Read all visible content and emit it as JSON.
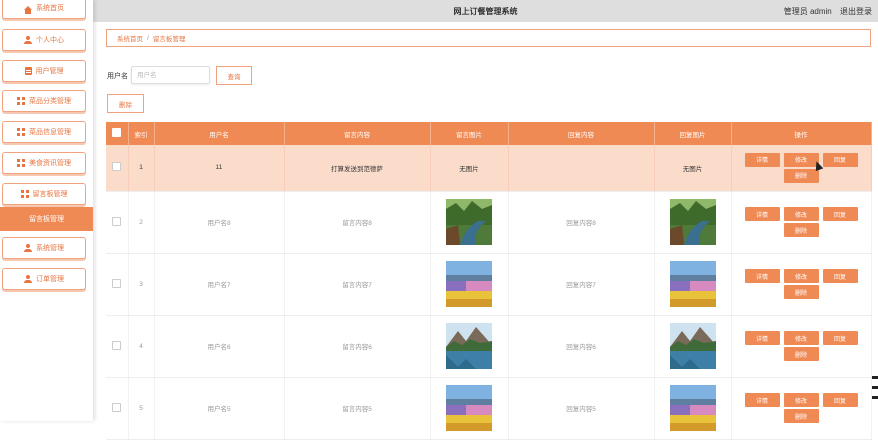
{
  "header": {
    "title": "网上订餐管理系统",
    "admin_label": "管理员 admin",
    "logout_label": "退出登录"
  },
  "sidebar": {
    "items": [
      {
        "label": "系统首页",
        "icon": "home-icon"
      },
      {
        "label": "个人中心",
        "icon": "user-icon"
      },
      {
        "label": "用户管理",
        "icon": "document-icon"
      },
      {
        "label": "菜品分类管理",
        "icon": "grid-icon"
      },
      {
        "label": "菜品信息管理",
        "icon": "grid-icon"
      },
      {
        "label": "美食资讯管理",
        "icon": "grid-icon"
      },
      {
        "label": "留言板管理",
        "icon": "grid-icon"
      },
      {
        "label": "留言板管理",
        "icon": "",
        "active": true
      },
      {
        "label": "系统管理",
        "icon": "user-icon"
      },
      {
        "label": "订单管理",
        "icon": "user-icon"
      }
    ]
  },
  "breadcrumb": {
    "home": "系统首页",
    "separator": "/",
    "current": "留言板管理"
  },
  "search": {
    "label": "用户名",
    "placeholder": "用户名",
    "button_label": "查询"
  },
  "toolbar": {
    "delete_label": "删除"
  },
  "table": {
    "columns": [
      "索引",
      "用户名",
      "留言内容",
      "留言图片",
      "回复内容",
      "回复图片",
      "操作"
    ],
    "actions": [
      "详情",
      "修改",
      "回复",
      "删除"
    ],
    "rows": [
      {
        "index": "1",
        "username": "11",
        "message": "打算发送到范德萨",
        "msg_image_text": "无图片",
        "reply": "",
        "reply_image_text": "无图片",
        "msg_image": "",
        "reply_image": ""
      },
      {
        "index": "2",
        "username": "用户名8",
        "message": "留言内容8",
        "msg_image_text": "",
        "reply": "回复内容8",
        "reply_image_text": "",
        "msg_image": "forest-river",
        "reply_image": "forest-river"
      },
      {
        "index": "3",
        "username": "用户名7",
        "message": "留言内容7",
        "msg_image_text": "",
        "reply": "回复内容7",
        "reply_image_text": "",
        "msg_image": "flower-field",
        "reply_image": "flower-field"
      },
      {
        "index": "4",
        "username": "用户名6",
        "message": "留言内容6",
        "msg_image_text": "",
        "reply": "回复内容6",
        "reply_image_text": "",
        "msg_image": "mountain-lake",
        "reply_image": "mountain-lake"
      },
      {
        "index": "5",
        "username": "用户名5",
        "message": "留言内容5",
        "msg_image_text": "",
        "reply": "回复内容5",
        "reply_image_text": "",
        "msg_image": "flower-field",
        "reply_image": "flower-field"
      }
    ]
  },
  "colors": {
    "accent": "#f08a55",
    "accent_text": "#e8743f",
    "highlight_row": "#fbdccb"
  }
}
